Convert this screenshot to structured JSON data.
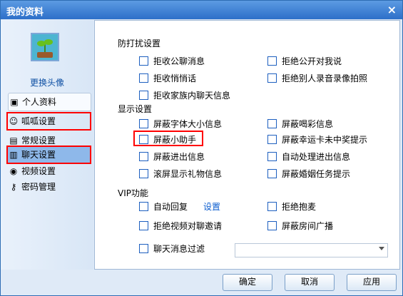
{
  "window": {
    "title": "我的资料",
    "close_icon": "close-icon"
  },
  "sidebar": {
    "change_avatar": "更换头像",
    "items": [
      {
        "label": "个人资料",
        "icon": "profile-card-icon"
      },
      {
        "label": "呱呱设置",
        "icon": "frog-icon"
      },
      {
        "label": "常规设置",
        "icon": "document-icon"
      },
      {
        "label": "聊天设置",
        "icon": "chat-icon"
      },
      {
        "label": "视频设置",
        "icon": "camera-icon"
      },
      {
        "label": "密码管理",
        "icon": "key-icon"
      }
    ]
  },
  "panel": {
    "groups": [
      {
        "title": "防打扰设置",
        "options": [
          "拒收公聊消息",
          "拒绝公开对我说",
          "拒收悄悄话",
          "拒绝别人录音录像拍照",
          "拒收家族内聊天信息"
        ]
      },
      {
        "title": "显示设置",
        "options": [
          "屏蔽字体大小信息",
          "屏蔽喝彩信息",
          "屏蔽小助手",
          "屏蔽幸运卡未中奖提示",
          "屏蔽进出信息",
          "自动处理进出信息",
          "滚屏显示礼物信息",
          "屏蔽婚姻任务提示"
        ]
      },
      {
        "title": "VIP功能",
        "options": [
          "自动回复",
          "拒绝抱麦",
          "拒绝视频对聊邀请",
          "屏蔽房间广播",
          "聊天消息过滤"
        ],
        "settings_link": "设置",
        "filter_value": ""
      }
    ]
  },
  "buttons": {
    "ok": "确定",
    "cancel": "取消",
    "apply": "应用"
  },
  "colors": {
    "title_bar": "#2d6fc9",
    "highlight": "#ff0000",
    "link": "#0b5ccf"
  }
}
